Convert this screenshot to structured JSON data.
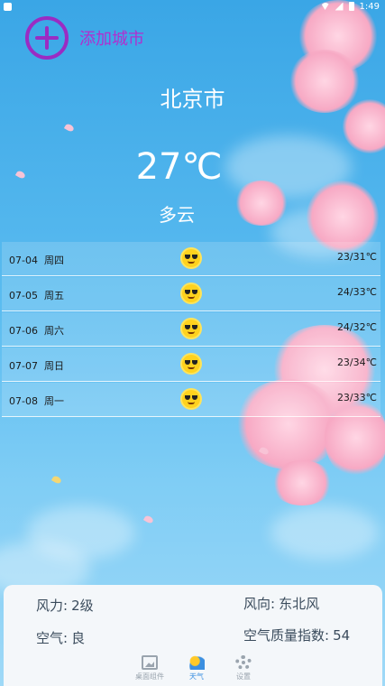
{
  "status_bar": {
    "time": "1:49"
  },
  "header": {
    "add_city_label": "添加城市"
  },
  "current": {
    "city": "北京市",
    "temperature": "27℃",
    "condition": "多云"
  },
  "forecast": [
    {
      "date": "07-04",
      "weekday": "周四",
      "icon": "sunglasses-sun-icon",
      "range": "23/31℃"
    },
    {
      "date": "07-05",
      "weekday": "周五",
      "icon": "sunglasses-sun-icon",
      "range": "24/33℃"
    },
    {
      "date": "07-06",
      "weekday": "周六",
      "icon": "sunglasses-sun-icon",
      "range": "24/32℃"
    },
    {
      "date": "07-07",
      "weekday": "周日",
      "icon": "sunglasses-sun-icon",
      "range": "23/34℃"
    },
    {
      "date": "07-08",
      "weekday": "周一",
      "icon": "sunglasses-sun-icon",
      "range": "23/33℃"
    }
  ],
  "details": {
    "wind_power_label": "风力:",
    "wind_power_value": "2级",
    "wind_dir_label": "风向:",
    "wind_dir_value": "东北风",
    "air_label": "空气:",
    "air_value": "良",
    "aqi_label": "空气质量指数:",
    "aqi_value": "54"
  },
  "nav": [
    {
      "label": "桌面组件",
      "icon": "picture-icon"
    },
    {
      "label": "天气",
      "icon": "weather-icon",
      "active": true
    },
    {
      "label": "设置",
      "icon": "gear-icon"
    }
  ],
  "colors": {
    "accent": "#9a2cc3",
    "nav_active": "#3b8fe0",
    "sky": "#3aa6e6"
  }
}
